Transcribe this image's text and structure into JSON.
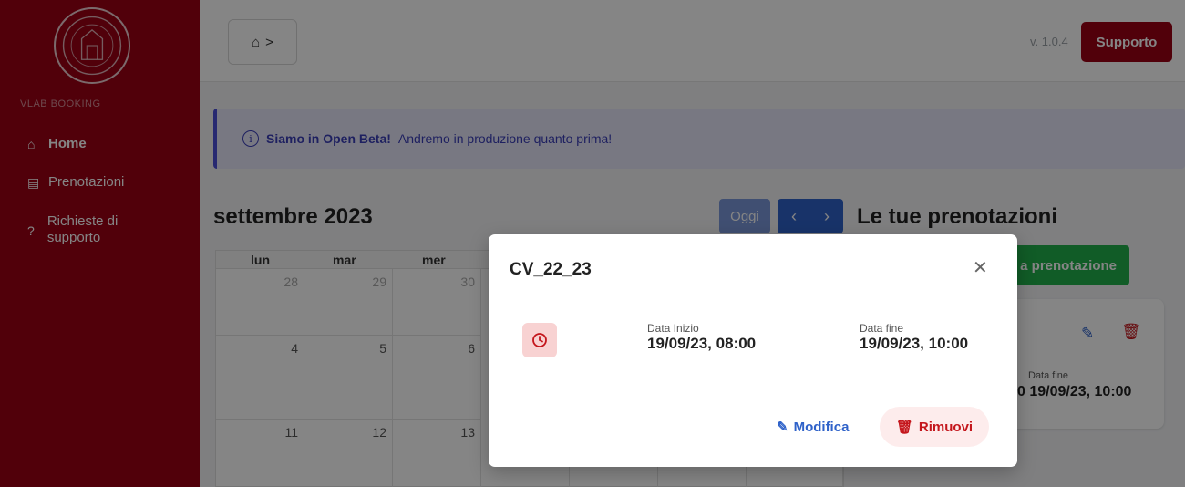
{
  "app": {
    "label": "VLAB BOOKING",
    "version": "v. 1.0.4",
    "support_label": "Supporto"
  },
  "sidebar": {
    "items": [
      {
        "label": "Home",
        "icon": "home-icon",
        "active": true
      },
      {
        "label": "Prenotazioni",
        "icon": "list-icon",
        "active": false
      },
      {
        "label": "Richieste di supporto",
        "icon": "question-icon",
        "active": false
      }
    ]
  },
  "breadcrumb": {
    "separator": ">"
  },
  "banner": {
    "strong": "Siamo in Open Beta!",
    "text": "Andremo in produzione quanto prima!"
  },
  "calendar": {
    "month_title": "settembre 2023",
    "today_label": "Oggi",
    "weekdays": [
      "lun",
      "mar",
      "mer"
    ],
    "rows": [
      [
        "28",
        "29",
        "30"
      ],
      [
        "4",
        "5",
        "6"
      ],
      [
        "11",
        "12",
        "13"
      ]
    ]
  },
  "reservations": {
    "title": "Le tue prenotazioni",
    "new_button": "a prenotazione",
    "card": {
      "end_label": "Data fine",
      "end_value": "0 19/09/23, 10:00"
    }
  },
  "modal": {
    "title": "CV_22_23",
    "start_label": "Data Inizio",
    "start_value": "19/09/23, 08:00",
    "end_label": "Data fine",
    "end_value": "19/09/23, 10:00",
    "edit_label": "Modifica",
    "remove_label": "Rimuovi"
  },
  "colors": {
    "brand": "#9b0014",
    "primary": "#2f62c9",
    "success": "#22b14c",
    "danger": "#c4161c"
  }
}
